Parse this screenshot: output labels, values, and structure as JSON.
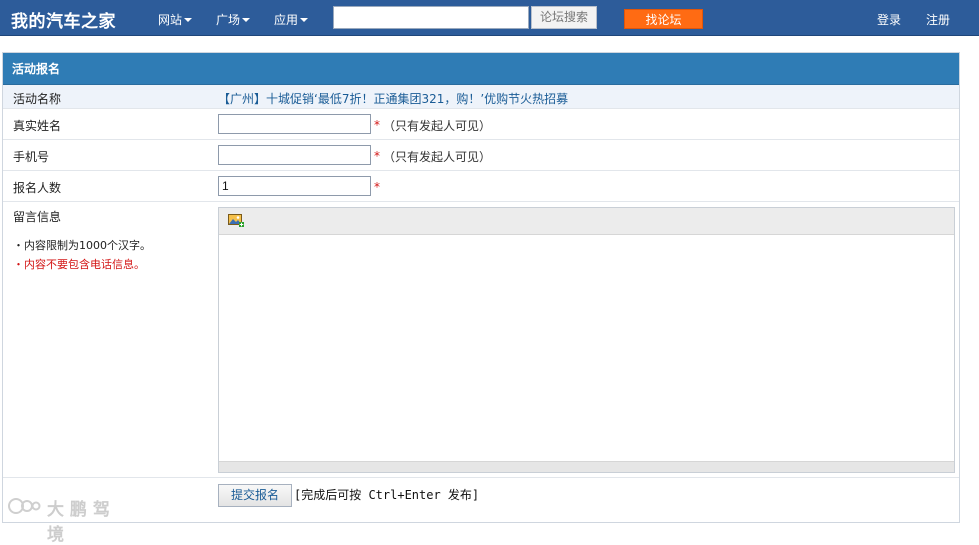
{
  "topbar": {
    "logo": "我的汽车之家",
    "nav": [
      {
        "label": "网站"
      },
      {
        "label": "广场"
      },
      {
        "label": "应用"
      }
    ],
    "search": {
      "value": "",
      "button": "论坛搜索"
    },
    "find_forum": "找论坛",
    "login": "登录",
    "register": "注册"
  },
  "form": {
    "header": "活动报名",
    "activity": {
      "label": "活动名称",
      "value": "【广州】十城促销‘最低7折！正通集团321，购！’优购节火热招募"
    },
    "real_name": {
      "label": "真实姓名",
      "value": "",
      "required": "*",
      "hint": "（只有发起人可见）"
    },
    "phone": {
      "label": "手机号",
      "value": "",
      "required": "*",
      "hint": "（只有发起人可见）"
    },
    "count": {
      "label": "报名人数",
      "value": "1",
      "required": "*"
    },
    "message": {
      "label": "留言信息",
      "note_limit": "・内容限制为1000个汉字。",
      "note_no_phone": "・内容不要包含电话信息。",
      "value": ""
    },
    "submit": {
      "label": "提交报名",
      "hint": "[完成后可按 Ctrl+Enter 发布]"
    }
  },
  "watermark": "大 鹏 驾 境",
  "colors": {
    "topbar": "#2d5c9a",
    "header": "#2f7cb5",
    "accent_orange": "#ff6b13",
    "required_red": "#d31616",
    "link_blue": "#1a5c96"
  }
}
